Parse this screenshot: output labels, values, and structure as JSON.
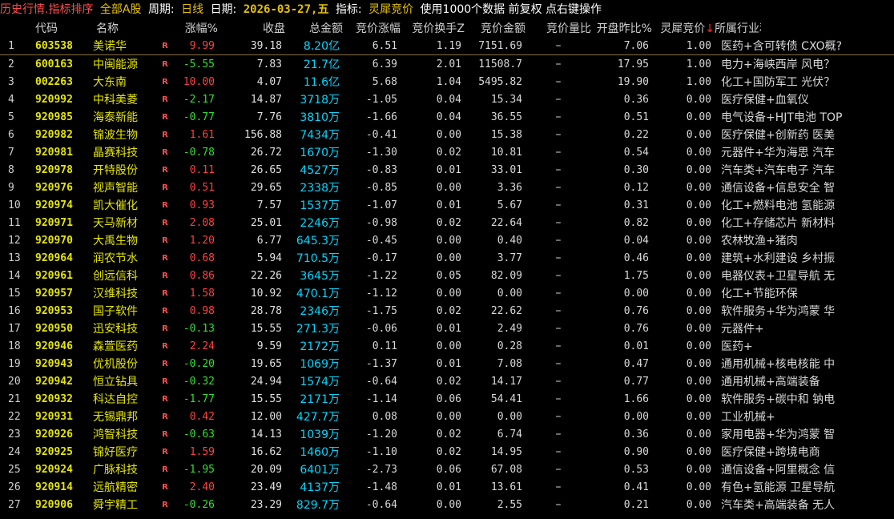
{
  "header": {
    "title": "历史行情.指标排序",
    "scope": "全部A股",
    "period_label": "周期:",
    "period_value": "日线",
    "date_label": "日期:",
    "date_value": "2026-03-27,五",
    "indicator_label": "指标:",
    "indicator_value": "灵犀竞价",
    "note": "使用1000个数据 前复权 点右键操作"
  },
  "columns": {
    "code": "代码",
    "name": "名称",
    "chg": "涨幅%",
    "close": "收盘",
    "amount": "总金额",
    "bid_chg": "竞价涨幅",
    "bid_turnover": "竞价换手Z",
    "bid_amount": "竞价金额",
    "bid_volratio": "竞价量比",
    "open_ratio": "开盘昨比%",
    "lingxi": "灵犀竞价",
    "sort_arrow": "↓",
    "industry": "所属行业和概念"
  },
  "flag": "R",
  "rows": [
    {
      "idx": "1",
      "code": "603538",
      "name": "美诺华",
      "chg": "9.99",
      "dir": "up",
      "close": "39.18",
      "amount": "8.20亿",
      "bid_chg": "6.51",
      "bid_turnover": "1.19",
      "bid_amount": "7151.69",
      "volratio": "–",
      "open_ratio": "7.06",
      "lingxi": "1.00",
      "industry": "医药+含可转债 CXO概?"
    },
    {
      "idx": "2",
      "code": "600163",
      "name": "中闽能源",
      "chg": "-5.55",
      "dir": "down",
      "close": "7.83",
      "amount": "21.7亿",
      "bid_chg": "6.39",
      "bid_turnover": "2.01",
      "bid_amount": "11508.7",
      "volratio": "–",
      "open_ratio": "17.95",
      "lingxi": "1.00",
      "industry": "电力+海峡西岸 风电？"
    },
    {
      "idx": "3",
      "code": "002263",
      "name": "大东南",
      "chg": "10.00",
      "dir": "up",
      "close": "4.07",
      "amount": "11.6亿",
      "bid_chg": "5.68",
      "bid_turnover": "1.04",
      "bid_amount": "5495.82",
      "volratio": "–",
      "open_ratio": "19.90",
      "lingxi": "1.00",
      "industry": "化工+国防军工 光伏？"
    },
    {
      "idx": "4",
      "code": "920992",
      "name": "中科美菱",
      "chg": "-2.17",
      "dir": "down",
      "close": "14.87",
      "amount": "3718万",
      "bid_chg": "-1.05",
      "bid_turnover": "0.04",
      "bid_amount": "15.34",
      "volratio": "–",
      "open_ratio": "0.36",
      "lingxi": "0.00",
      "industry": "医疗保健+血氧仪"
    },
    {
      "idx": "5",
      "code": "920985",
      "name": "海泰新能",
      "chg": "-0.77",
      "dir": "down",
      "close": "7.76",
      "amount": "3810万",
      "bid_chg": "-1.66",
      "bid_turnover": "0.04",
      "bid_amount": "36.55",
      "volratio": "–",
      "open_ratio": "0.51",
      "lingxi": "0.00",
      "industry": "电气设备+HJT电池 TOP"
    },
    {
      "idx": "6",
      "code": "920982",
      "name": "锦波生物",
      "chg": "1.61",
      "dir": "up",
      "close": "156.88",
      "amount": "7434万",
      "bid_chg": "-0.41",
      "bid_turnover": "0.00",
      "bid_amount": "15.38",
      "volratio": "–",
      "open_ratio": "0.22",
      "lingxi": "0.00",
      "industry": "医疗保健+创新药 医美"
    },
    {
      "idx": "7",
      "code": "920981",
      "name": "晶赛科技",
      "chg": "-0.78",
      "dir": "down",
      "close": "26.72",
      "amount": "1670万",
      "bid_chg": "-1.30",
      "bid_turnover": "0.02",
      "bid_amount": "10.81",
      "volratio": "–",
      "open_ratio": "0.54",
      "lingxi": "0.00",
      "industry": "元器件+华为海思 汽车"
    },
    {
      "idx": "8",
      "code": "920978",
      "name": "开特股份",
      "chg": "0.11",
      "dir": "up",
      "close": "26.65",
      "amount": "4527万",
      "bid_chg": "-0.83",
      "bid_turnover": "0.01",
      "bid_amount": "33.01",
      "volratio": "–",
      "open_ratio": "0.30",
      "lingxi": "0.00",
      "industry": "汽车类+汽车电子 汽车"
    },
    {
      "idx": "9",
      "code": "920976",
      "name": "视声智能",
      "chg": "0.51",
      "dir": "up",
      "close": "29.65",
      "amount": "2338万",
      "bid_chg": "-0.85",
      "bid_turnover": "0.00",
      "bid_amount": "3.36",
      "volratio": "–",
      "open_ratio": "0.12",
      "lingxi": "0.00",
      "industry": "通信设备+信息安全 智"
    },
    {
      "idx": "10",
      "code": "920974",
      "name": "凯大催化",
      "chg": "0.93",
      "dir": "up",
      "close": "7.57",
      "amount": "1537万",
      "bid_chg": "-1.07",
      "bid_turnover": "0.01",
      "bid_amount": "5.67",
      "volratio": "–",
      "open_ratio": "0.31",
      "lingxi": "0.00",
      "industry": "化工+燃料电池 氢能源"
    },
    {
      "idx": "11",
      "code": "920971",
      "name": "天马新材",
      "chg": "2.08",
      "dir": "up",
      "close": "25.01",
      "amount": "2246万",
      "bid_chg": "-0.98",
      "bid_turnover": "0.02",
      "bid_amount": "22.64",
      "volratio": "–",
      "open_ratio": "0.82",
      "lingxi": "0.00",
      "industry": "化工+存储芯片 新材料"
    },
    {
      "idx": "12",
      "code": "920970",
      "name": "大禹生物",
      "chg": "1.20",
      "dir": "up",
      "close": "6.77",
      "amount": "645.3万",
      "bid_chg": "-0.45",
      "bid_turnover": "0.00",
      "bid_amount": "0.40",
      "volratio": "–",
      "open_ratio": "0.04",
      "lingxi": "0.00",
      "industry": "农林牧渔+猪肉"
    },
    {
      "idx": "13",
      "code": "920964",
      "name": "润农节水",
      "chg": "0.68",
      "dir": "up",
      "close": "5.94",
      "amount": "710.5万",
      "bid_chg": "-0.17",
      "bid_turnover": "0.00",
      "bid_amount": "3.77",
      "volratio": "–",
      "open_ratio": "0.46",
      "lingxi": "0.00",
      "industry": "建筑+水利建设 乡村振"
    },
    {
      "idx": "14",
      "code": "920961",
      "name": "创远信科",
      "chg": "0.86",
      "dir": "up",
      "close": "22.26",
      "amount": "3645万",
      "bid_chg": "-1.22",
      "bid_turnover": "0.05",
      "bid_amount": "82.09",
      "volratio": "–",
      "open_ratio": "1.75",
      "lingxi": "0.00",
      "industry": "电器仪表+卫星导航 无"
    },
    {
      "idx": "15",
      "code": "920957",
      "name": "汉维科技",
      "chg": "1.58",
      "dir": "up",
      "close": "10.92",
      "amount": "470.1万",
      "bid_chg": "-1.12",
      "bid_turnover": "0.00",
      "bid_amount": "0.00",
      "volratio": "–",
      "open_ratio": "0.00",
      "lingxi": "0.00",
      "industry": "化工+节能环保"
    },
    {
      "idx": "16",
      "code": "920953",
      "name": "国子软件",
      "chg": "0.98",
      "dir": "up",
      "close": "28.78",
      "amount": "2346万",
      "bid_chg": "-1.75",
      "bid_turnover": "0.02",
      "bid_amount": "22.62",
      "volratio": "–",
      "open_ratio": "0.76",
      "lingxi": "0.00",
      "industry": "软件服务+华为鸿蒙 华"
    },
    {
      "idx": "17",
      "code": "920950",
      "name": "迅安科技",
      "chg": "-0.13",
      "dir": "down",
      "close": "15.55",
      "amount": "271.3万",
      "bid_chg": "-0.06",
      "bid_turnover": "0.01",
      "bid_amount": "2.49",
      "volratio": "–",
      "open_ratio": "0.76",
      "lingxi": "0.00",
      "industry": "元器件+"
    },
    {
      "idx": "18",
      "code": "920946",
      "name": "森萱医药",
      "chg": "2.24",
      "dir": "up",
      "close": "9.59",
      "amount": "2172万",
      "bid_chg": "0.11",
      "bid_turnover": "0.00",
      "bid_amount": "0.28",
      "volratio": "–",
      "open_ratio": "0.01",
      "lingxi": "0.00",
      "industry": "医药+"
    },
    {
      "idx": "19",
      "code": "920943",
      "name": "优机股份",
      "chg": "-0.20",
      "dir": "down",
      "close": "19.65",
      "amount": "1069万",
      "bid_chg": "-1.37",
      "bid_turnover": "0.01",
      "bid_amount": "7.08",
      "volratio": "–",
      "open_ratio": "0.47",
      "lingxi": "0.00",
      "industry": "通用机械+核电核能 中"
    },
    {
      "idx": "20",
      "code": "920942",
      "name": "恒立钻具",
      "chg": "-0.32",
      "dir": "down",
      "close": "24.94",
      "amount": "1574万",
      "bid_chg": "-0.64",
      "bid_turnover": "0.02",
      "bid_amount": "14.17",
      "volratio": "–",
      "open_ratio": "0.77",
      "lingxi": "0.00",
      "industry": "通用机械+高端装备"
    },
    {
      "idx": "21",
      "code": "920932",
      "name": "科达自控",
      "chg": "-1.77",
      "dir": "down",
      "close": "15.55",
      "amount": "2171万",
      "bid_chg": "-1.14",
      "bid_turnover": "0.06",
      "bid_amount": "54.41",
      "volratio": "–",
      "open_ratio": "1.66",
      "lingxi": "0.00",
      "industry": "软件服务+碳中和 钠电"
    },
    {
      "idx": "22",
      "code": "920931",
      "name": "无锡鼎邦",
      "chg": "0.42",
      "dir": "up",
      "close": "12.00",
      "amount": "427.7万",
      "bid_chg": "0.08",
      "bid_turnover": "0.00",
      "bid_amount": "0.00",
      "volratio": "–",
      "open_ratio": "0.00",
      "lingxi": "0.00",
      "industry": "工业机械+"
    },
    {
      "idx": "23",
      "code": "920926",
      "name": "鸿智科技",
      "chg": "-0.63",
      "dir": "down",
      "close": "14.13",
      "amount": "1039万",
      "bid_chg": "-1.20",
      "bid_turnover": "0.02",
      "bid_amount": "6.74",
      "volratio": "–",
      "open_ratio": "0.36",
      "lingxi": "0.00",
      "industry": "家用电器+华为鸿蒙 智"
    },
    {
      "idx": "24",
      "code": "920925",
      "name": "锦好医疗",
      "chg": "1.59",
      "dir": "up",
      "close": "16.62",
      "amount": "1460万",
      "bid_chg": "-1.10",
      "bid_turnover": "0.02",
      "bid_amount": "14.95",
      "volratio": "–",
      "open_ratio": "0.90",
      "lingxi": "0.00",
      "industry": "医疗保健+跨境电商"
    },
    {
      "idx": "25",
      "code": "920924",
      "name": "广脉科技",
      "chg": "-1.95",
      "dir": "down",
      "close": "20.09",
      "amount": "6401万",
      "bid_chg": "-2.73",
      "bid_turnover": "0.06",
      "bid_amount": "67.08",
      "volratio": "–",
      "open_ratio": "0.53",
      "lingxi": "0.00",
      "industry": "通信设备+阿里概念 信"
    },
    {
      "idx": "26",
      "code": "920914",
      "name": "远航精密",
      "chg": "2.40",
      "dir": "up",
      "close": "23.49",
      "amount": "4137万",
      "bid_chg": "-1.48",
      "bid_turnover": "0.01",
      "bid_amount": "13.61",
      "volratio": "–",
      "open_ratio": "0.41",
      "lingxi": "0.00",
      "industry": "有色+氢能源 卫星导航"
    },
    {
      "idx": "27",
      "code": "920906",
      "name": "舜宇精工",
      "chg": "-0.26",
      "dir": "down",
      "close": "23.29",
      "amount": "829.7万",
      "bid_chg": "-0.64",
      "bid_turnover": "0.00",
      "bid_amount": "2.55",
      "volratio": "–",
      "open_ratio": "0.21",
      "lingxi": "0.00",
      "industry": "汽车类+高端装备 无人"
    }
  ]
}
